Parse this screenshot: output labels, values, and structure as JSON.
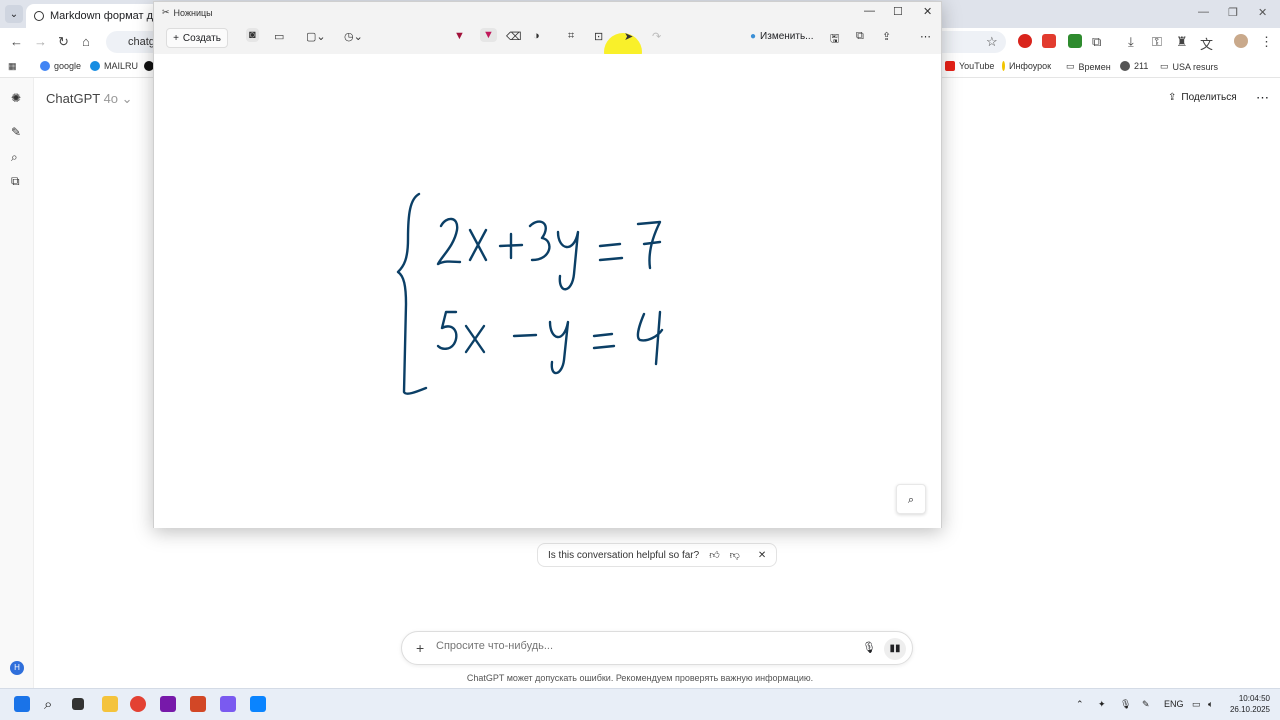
{
  "browser": {
    "tab_title": "Markdown формат для Obsid",
    "address": "chatgpt",
    "bookmarks": [
      "google",
      "MAILRU",
      "YouTube",
      "Инфоурок",
      "Времен",
      "211",
      "USA resurs"
    ]
  },
  "chatgpt": {
    "model_name": "ChatGPT",
    "model_version": "4o",
    "share_label": "Поделиться",
    "avatar_initial": "H",
    "feedback_question": "Is this conversation helpful so far?",
    "prompt_placeholder": "Спросите что-нибудь...",
    "disclaimer": "ChatGPT может допускать ошибки. Рекомендуем проверять важную информацию."
  },
  "snipping_tool": {
    "title": "Ножницы",
    "create_label": "Создать",
    "edit_label": "Изменить...",
    "handwritten_lines": [
      "2x+3y = 7",
      "5x − y = 4"
    ]
  },
  "taskbar": {
    "language": "ENG",
    "time": "10:04:50",
    "date": "26.10.2025"
  },
  "colors": {
    "ink": "#0b3f66",
    "cursor_highlight": "#f5ea14",
    "accent": "#2f6fdb"
  }
}
